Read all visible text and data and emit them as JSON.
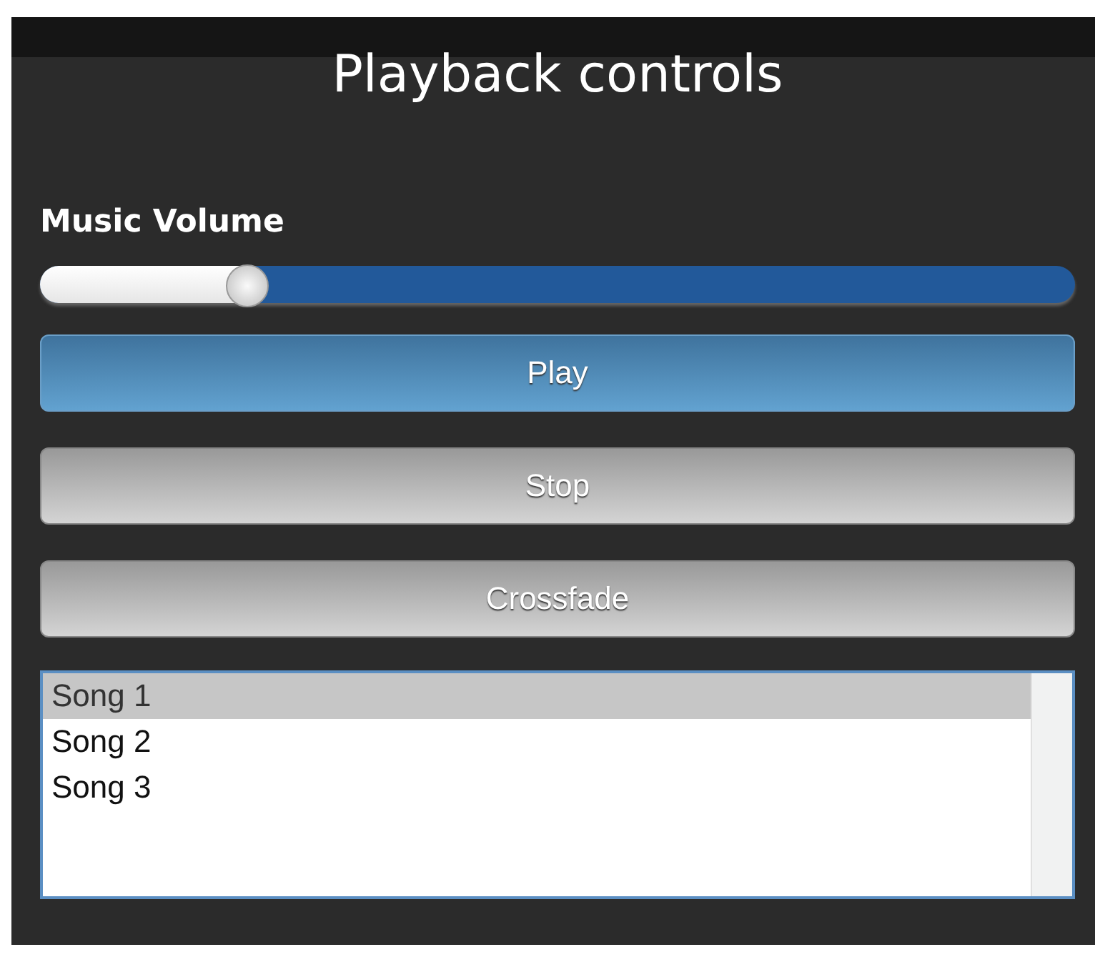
{
  "title": "Playback controls",
  "volume": {
    "label": "Music Volume",
    "level": 0.2
  },
  "buttons": [
    {
      "label": "Play",
      "kind": "primary"
    },
    {
      "label": "Stop",
      "kind": "default"
    },
    {
      "label": "Crossfade",
      "kind": "default"
    }
  ],
  "songs": [
    {
      "label": "Song 1",
      "selected": true
    },
    {
      "label": "Song 2",
      "selected": false
    },
    {
      "label": "Song 3",
      "selected": false
    }
  ]
}
